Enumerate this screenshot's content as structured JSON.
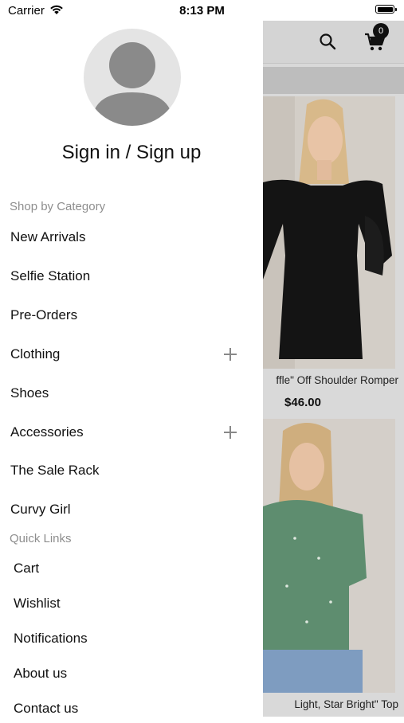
{
  "status_bar": {
    "carrier": "Carrier",
    "time": "8:13 PM"
  },
  "header": {
    "cart_count": "0"
  },
  "products": [
    {
      "name": "\"Ruffle\" Off Shoulder Romper",
      "name_visible": "ffle\" Off Shoulder Romper",
      "price": "$46.00"
    },
    {
      "name": "\"Light, Star Bright\" Top",
      "name_visible": "Light, Star Bright\" Top"
    }
  ],
  "drawer": {
    "signin_label": "Sign in / Sign up",
    "category_title": "Shop by Category",
    "categories": [
      {
        "label": "New Arrivals",
        "expandable": false
      },
      {
        "label": "Selfie Station",
        "expandable": false
      },
      {
        "label": "Pre-Orders",
        "expandable": false
      },
      {
        "label": "Clothing",
        "expandable": true
      },
      {
        "label": "Shoes",
        "expandable": false
      },
      {
        "label": "Accessories",
        "expandable": true
      },
      {
        "label": "The Sale Rack",
        "expandable": false
      },
      {
        "label": "Curvy Girl",
        "expandable": false
      }
    ],
    "quick_links_title": "Quick Links",
    "quick_links": [
      {
        "label": "Cart"
      },
      {
        "label": "Wishlist"
      },
      {
        "label": "Notifications"
      },
      {
        "label": "About us"
      },
      {
        "label": "Contact us"
      }
    ]
  },
  "icons": {
    "wifi": "wifi-icon",
    "battery": "battery-icon",
    "search": "search-icon",
    "cart": "cart-icon",
    "avatar": "avatar-placeholder-icon",
    "expand": "plus-icon"
  },
  "colors": {
    "overlay": "#d9d9d9",
    "section_title": "#8e8e8e",
    "badge": "#111111"
  }
}
